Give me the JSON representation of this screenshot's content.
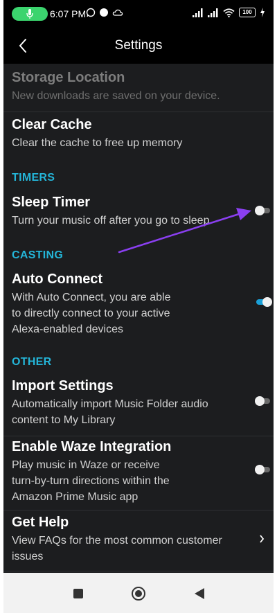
{
  "status_bar": {
    "time": "6:07 PM",
    "battery": "100",
    "icons": [
      "mic-icon",
      "whatsapp-icon",
      "circle-icon",
      "cloud-icon",
      "signal-icon",
      "signal-icon",
      "wifi-icon",
      "battery-icon",
      "charging-icon"
    ]
  },
  "header": {
    "title": "Settings",
    "back_icon": "back-arrow-icon"
  },
  "items": {
    "storage": {
      "title": "Storage Location",
      "subtitle": "New downloads are saved on your device."
    },
    "cache": {
      "title": "Clear Cache",
      "subtitle": "Clear the cache to free up memory"
    },
    "sleep": {
      "title": "Sleep Timer",
      "subtitle": "Turn your music off after you go to sleep",
      "enabled": false
    },
    "auto_connect": {
      "title": "Auto Connect",
      "subtitle_lines": [
        "With Auto Connect, you are able",
        "to directly connect to your active",
        "Alexa-enabled devices"
      ],
      "enabled": true
    },
    "import": {
      "title": "Import Settings",
      "subtitle_lines": [
        "Automatically import Music Folder audio",
        "content to My Library"
      ],
      "enabled": false
    },
    "waze": {
      "title": "Enable Waze Integration",
      "subtitle_lines": [
        "Play music in Waze or receive",
        "turn-by-turn directions within the",
        "Amazon Prime Music app"
      ],
      "enabled": false
    },
    "help": {
      "title": "Get Help",
      "subtitle_lines": [
        "View FAQs for the most common customer",
        "issues"
      ]
    }
  },
  "sections": {
    "timers": "TIMERS",
    "casting": "CASTING",
    "other": "OTHER"
  },
  "annotation": {
    "arrow_color": "#8a3ff0",
    "points_to": "sleep-timer-toggle"
  },
  "colors": {
    "accent": "#24b5d8",
    "toggle_on": "#1aa0d8",
    "background": "#1c1d1f"
  },
  "navbar": {
    "icons": [
      "square-icon",
      "home-circle-icon",
      "back-triangle-icon"
    ]
  }
}
